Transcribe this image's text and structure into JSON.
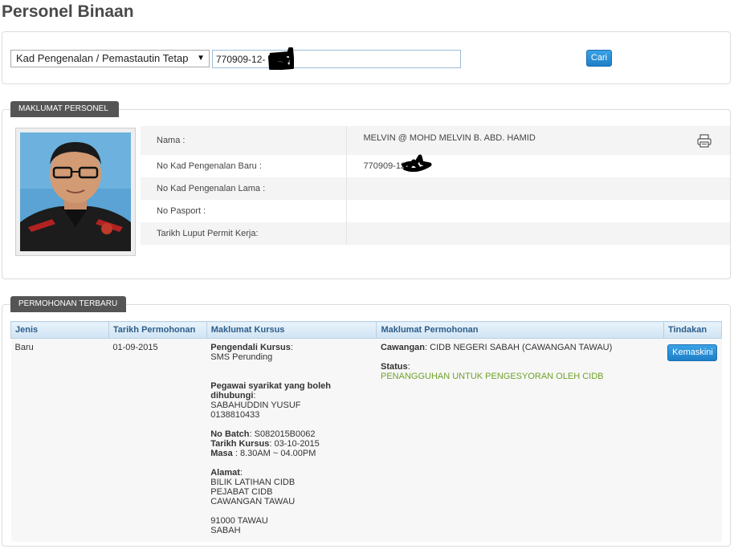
{
  "page": {
    "title": "Personel Binaan"
  },
  "search": {
    "type_selected": "Kad Pengenalan / Pemastautin Tetap",
    "query_value": "770909-12-",
    "button_label": "Cari"
  },
  "personel": {
    "tab_label": "MAKLUMAT PERSONEL",
    "rows": [
      {
        "label": "Nama :",
        "value": "MELVIN @ MOHD MELVIN B. ABD. HAMID"
      },
      {
        "label": "No Kad Pengenalan Baru :",
        "value": "770909-12"
      },
      {
        "label": "No Kad Pengenalan Lama :",
        "value": ""
      },
      {
        "label": "No Pasport :",
        "value": ""
      },
      {
        "label": "Tarikh Luput Permit Kerja:",
        "value": ""
      }
    ]
  },
  "permohonan": {
    "tab_label": "PERMOHONAN TERBARU",
    "columns": [
      "Jenis",
      "Tarikh Permohonan",
      "Maklumat Kursus",
      "Maklumat Permohonan",
      "Tindakan"
    ],
    "row": {
      "jenis": "Baru",
      "tarikh": "01-09-2015",
      "kursus": {
        "pengendali_label": "Pengendali Kursus",
        "pengendali_value": "SMS Perunding",
        "pegawai_label": "Pegawai syarikat yang boleh dihubungi",
        "pegawai_name": "SABAHUDDIN YUSUF",
        "pegawai_phone": "0138810433",
        "batch_label": "No Batch",
        "batch_value": "S082015B0062",
        "tarikh_label": "Tarikh Kursus",
        "tarikh_value": "03-10-2015",
        "masa_label": "Masa",
        "masa_value": "8.30AM ~ 04.00PM",
        "alamat_label": "Alamat",
        "alamat_1": "BILIK LATIHAN CIDB",
        "alamat_2": "PEJABAT CIDB",
        "alamat_3": "CAWANGAN TAWAU",
        "alamat_4": "91000 TAWAU",
        "alamat_5": "SABAH"
      },
      "mohon": {
        "cawangan_label": "Cawangan",
        "cawangan_value": "CIDB NEGERI SABAH (CAWANGAN TAWAU)",
        "status_label": "Status",
        "status_value": "PENANGGUHAN UNTUK PENGESYORAN OLEH CIDB",
        "status_color": "#6fa12a"
      },
      "tindakan_button": "Kemaskini"
    }
  },
  "colors": {
    "accent": "#1f7fc7",
    "tab_bg": "#555555",
    "header_text": "#2d5e8a"
  }
}
